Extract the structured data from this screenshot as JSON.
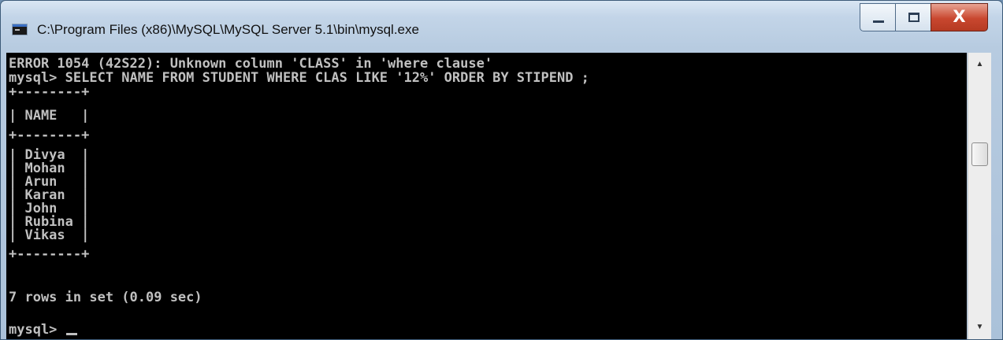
{
  "window": {
    "title": "C:\\Program Files (x86)\\MySQL\\MySQL Server 5.1\\bin\\mysql.exe"
  },
  "controls": {
    "close_glyph": "X"
  },
  "console": {
    "lines": [
      "ERROR 1054 (42S22): Unknown column 'CLASS' in 'where clause'",
      "mysql> SELECT NAME FROM STUDENT WHERE CLAS LIKE '12%' ORDER BY STIPEND ;",
      "+--------+",
      "| NAME   |",
      "+--------+",
      "| Divya  |",
      "| Mohan  |",
      "| Arun   |",
      "| Karan  |",
      "| John   |",
      "| Rubina |",
      "| Vikas  |",
      "+--------+",
      "7 rows in set (0.09 sec)",
      "",
      "mysql> "
    ]
  },
  "scrollbar": {
    "up_glyph": "▲",
    "down_glyph": "▼"
  }
}
